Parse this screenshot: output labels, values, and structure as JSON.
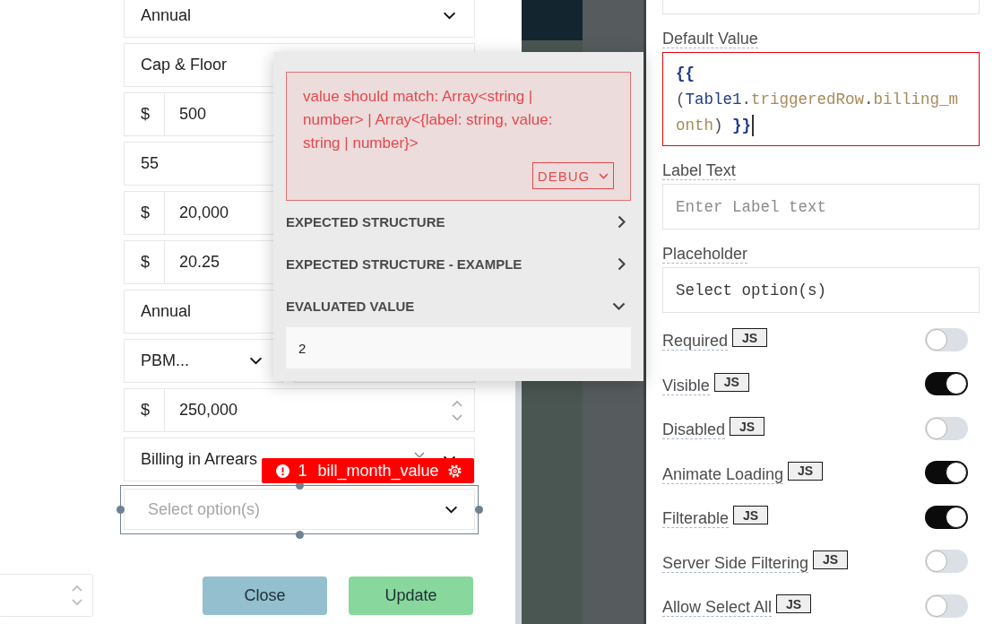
{
  "form": {
    "rows": [
      {
        "kind": "select",
        "value": "Annual"
      },
      {
        "kind": "input",
        "value": "Cap & Floor"
      },
      {
        "kind": "currency",
        "prefix": "$",
        "value": "500"
      },
      {
        "kind": "input",
        "value": "55"
      },
      {
        "kind": "currency",
        "prefix": "$",
        "value": "20,000"
      },
      {
        "kind": "currency",
        "prefix": "$",
        "value": "20.25"
      },
      {
        "kind": "input",
        "value": "Annual"
      },
      {
        "kind": "split",
        "fields": [
          {
            "kind": "select",
            "value": "PBM..."
          },
          {
            "kind": "input"
          }
        ]
      },
      {
        "kind": "currency",
        "prefix": "$",
        "value": "250,000",
        "stepper": true
      },
      {
        "kind": "select",
        "value": "Billing in Arrears",
        "clearable": true
      }
    ],
    "selected_widget": {
      "selected": true,
      "placeholder": "Select option(s)",
      "tag": {
        "error_count": "1",
        "name": "bill_month_value"
      }
    },
    "buttons": [
      {
        "label": "Close",
        "kind": "secondary"
      },
      {
        "label": "Update",
        "kind": "primary"
      }
    ]
  },
  "debugger_popup": {
    "error": "value should match: Array<string | number> | Array<{label: string, value: string | number}>",
    "debug_button": "DEBUG",
    "sections": [
      {
        "title": "EXPECTED STRUCTURE",
        "expanded": false
      },
      {
        "title": "EXPECTED STRUCTURE - EXAMPLE",
        "expanded": false
      },
      {
        "title": "EVALUATED VALUE",
        "expanded": true,
        "value": "2"
      }
    ]
  },
  "property_pane": {
    "default_value": {
      "label": "Default Value",
      "error": true,
      "focused": true,
      "code": [
        {
          "text": "{{",
          "kind": "brace"
        },
        {
          "text": " (",
          "kind": "punct"
        },
        {
          "text": "Table1",
          "kind": "variable"
        },
        {
          "text": ".",
          "kind": "punct"
        },
        {
          "text": "triggeredRow",
          "kind": "property"
        },
        {
          "text": ".",
          "kind": "punct"
        },
        {
          "text": "billing_month",
          "kind": "property"
        },
        {
          "text": ") ",
          "kind": "punct"
        },
        {
          "text": "}}",
          "kind": "brace"
        }
      ]
    },
    "label_text": {
      "label": "Label Text",
      "placeholder": "Enter Label text"
    },
    "placeholder": {
      "label": "Placeholder",
      "value": "Select option(s)"
    },
    "toggles": [
      {
        "label": "Required",
        "badge": "JS",
        "on": false
      },
      {
        "label": "Visible",
        "badge": "JS",
        "on": true
      },
      {
        "label": "Disabled",
        "badge": "JS",
        "on": false
      },
      {
        "label": "Animate Loading",
        "badge": "JS",
        "on": true
      },
      {
        "label": "Filterable",
        "badge": "JS",
        "on": true
      },
      {
        "label": "Server Side Filtering",
        "badge": "JS",
        "on": false
      },
      {
        "label": "Allow Select All",
        "badge": "JS",
        "on": false
      }
    ]
  }
}
